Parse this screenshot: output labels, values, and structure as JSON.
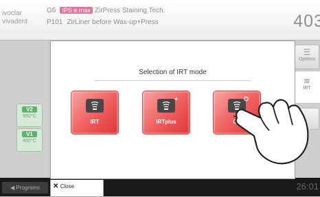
{
  "header": {
    "logo_line1": "ivoclar",
    "logo_line2": "vivadent",
    "program_group": "G6",
    "material_badge": "IPS e.max",
    "material_name": "ZirPress Staining Tech.",
    "program_number": "P101",
    "program_title": "ZirLiner before Wax-up+Press",
    "temperature": "403"
  },
  "left_panel": {
    "standby": [
      {
        "label": "V2",
        "value": "950°C"
      },
      {
        "label": "V1",
        "value": "450°C"
      }
    ]
  },
  "right_panel": {
    "options_label": "Options",
    "irt_label": "IRT"
  },
  "modal": {
    "title": "Selection of IRT mode",
    "modes": [
      {
        "label": "IRT",
        "icon": "irt-icon"
      },
      {
        "label": "IRTplus",
        "icon": "irtplus-icon",
        "sup": "+"
      },
      {
        "label": "Off",
        "icon": "irt-off-icon",
        "sup": "⏻"
      }
    ],
    "close_label": "Close"
  },
  "footer": {
    "programs_label": "◀ Programs",
    "time": "26:01"
  },
  "colors": {
    "mode_button": "#ef5d5d",
    "standby_green": "#5cb36b",
    "badge_pink": "#e0759c"
  }
}
